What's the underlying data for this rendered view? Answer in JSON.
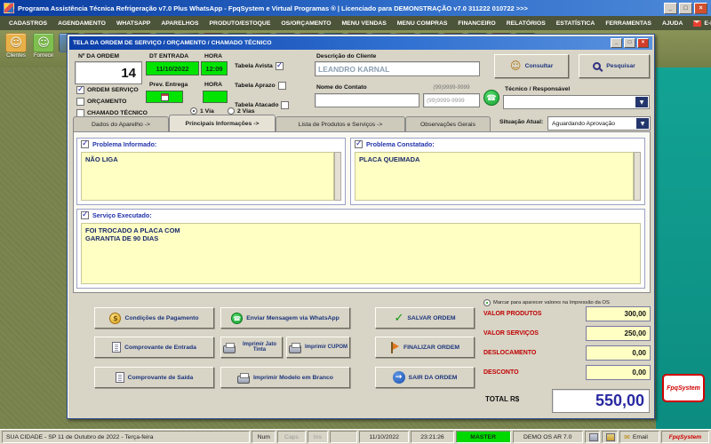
{
  "titlebar": {
    "title": "Programa Assistência Técnica Refrigeração v7.0 Plus WhatsApp  -  FpqSystem e Virtual Programas ®  | Licenciado para  DEMONSTRAÇÃO  v7.0 311222 010722  >>>",
    "controls": {
      "minimize": "_",
      "maximize": "□",
      "close": "×"
    }
  },
  "menubar": {
    "items": [
      "CADASTROS",
      "AGENDAMENTO",
      "WHATSAPP",
      "APARELHOS",
      "PRODUTO/ESTOQUE",
      "OS/ORÇAMENTO",
      "MENU VENDAS",
      "MENU COMPRAS",
      "FINANCEIRO",
      "RELATÓRIOS",
      "ESTATÍSTICA",
      "FERRAMENTAS",
      "AJUDA",
      "E-MAIL"
    ]
  },
  "toolbar": {
    "clientes_label": "Clientes",
    "fornecedores_label": "Fornece"
  },
  "dialog": {
    "title": "TELA DA ORDEM DE SERVIÇO / ORÇAMENTO / CHAMADO TÉCNICO",
    "order_number": {
      "label": "Nº DA ORDEM",
      "value": "14"
    },
    "type_checks": [
      "ORDEM SERVIÇO",
      "ORÇAMENTO",
      "CHAMADO TÉCNICO"
    ],
    "entrada": {
      "date_label": "DT ENTRADA",
      "hora_label": "HORA",
      "date": "11/10/2022",
      "hora": "12:09"
    },
    "previsao": {
      "label": "Prev. Entrega",
      "hora_label": "HORA"
    },
    "vias": [
      "1 Via",
      "2 Vias"
    ],
    "tabelas": [
      "Tabela Avista",
      "Tabela Aprazo",
      "Tabela Atacado"
    ],
    "cliente": {
      "label": "Descrição do Cliente",
      "value": "LEANDRO KARNAL"
    },
    "contato": {
      "label": "Nome do Contato",
      "phone_mask": "(99)9999-9999",
      "phone_value": "(99)9999-9999"
    },
    "consultar_label": "Consultar",
    "pesquisar_label": "Pesquisar",
    "tecnico_label": "Técnico / Responsável",
    "tabs": [
      "Dados do Aparelho ->",
      "Principais Informações ->",
      "Lista de Produtos e Serviços ->",
      "Observações Gerais"
    ],
    "situacao": {
      "label": "Situação Atual:",
      "value": "Aguardando Aprovação"
    },
    "problema_informado": {
      "label": "Problema Informado:",
      "value": "NÃO LIGA"
    },
    "problema_constatado": {
      "label": "Problema Constatado:",
      "value": "PLACA QUEIMADA"
    },
    "servico_executado": {
      "label": "Serviço Executado:",
      "value": "FOI TROCADO A PLACA COM\nGARANTIA DE 90 DIAS"
    },
    "buttons": {
      "condicoes_pagamento": "Condições de Pagamento",
      "comprovante_entrada": "Comprovante de Entrada",
      "comprovante_saida": "Comprovante de Saída",
      "whatsapp": "Enviar Mensagem via WhatsApp",
      "imprimir_jato": "Imprimir Jato Tinta",
      "imprimir_cupom": "Imprimir CUPOM",
      "imprimir_modelo": "Imprimir Modelo em Branco",
      "salvar": "SALVAR ORDEM",
      "finalizar": "FINALIZAR ORDEM",
      "sair": "SAIR DA ORDEM"
    },
    "valores": {
      "nota": "Marcar para aparecer valores na Impressão da OS",
      "rows": [
        {
          "label": "VALOR PRODUTOS",
          "value": "300,00"
        },
        {
          "label": "VALOR SERVIÇOS",
          "value": "250,00"
        },
        {
          "label": "DESLOCAMENTO",
          "value": "0,00"
        },
        {
          "label": "DESCONTO",
          "value": "0,00"
        }
      ],
      "total_label": "TOTAL R$",
      "total_value": "550,00"
    }
  },
  "statusbar": {
    "location": "SUA CIDADE - SP 11 de Outubro de 2022 - Terça-feira",
    "num": "Num",
    "caps": "Caps",
    "ins": "Ins",
    "date": "11/10/2022",
    "time": "23:21:26",
    "user": "MASTER",
    "demo": "DEMO OS AR 7.0",
    "email": "Email",
    "brand": "FpqSystem"
  },
  "desktop": {
    "logo": "FpqSystem"
  }
}
